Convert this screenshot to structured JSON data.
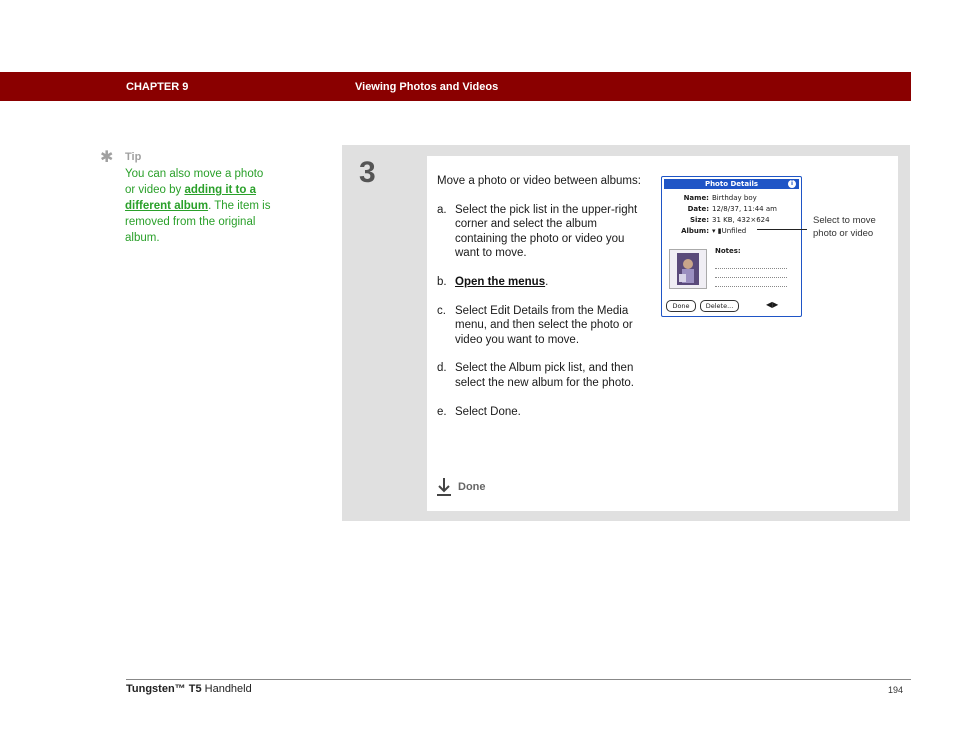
{
  "header": {
    "chapter": "CHAPTER 9",
    "section_title": "Viewing Photos and Videos"
  },
  "tip": {
    "label": "Tip",
    "text_before": "You can also move a photo or video by ",
    "link": "adding it to a different album",
    "text_after": ". The item is removed from the original album."
  },
  "step": {
    "number": "3",
    "intro": "Move a photo or video between albums:",
    "items": [
      {
        "letter": "a.",
        "text": "Select the pick list in the upper-right corner and select the album containing the photo or video you want to move."
      },
      {
        "letter": "b.",
        "link": "Open the menus",
        "suffix": "."
      },
      {
        "letter": "c.",
        "text": "Select Edit Details from the Media menu, and then select the photo or video you want to move."
      },
      {
        "letter": "d.",
        "text": "Select the Album pick list, and then select the new album for the photo."
      },
      {
        "letter": "e.",
        "text": "Select Done."
      }
    ],
    "done_label": "Done"
  },
  "device": {
    "title": "Photo Details",
    "info_icon": "i",
    "fields": {
      "name_label": "Name:",
      "name_value": "Birthday boy",
      "date_label": "Date:",
      "date_value": "12/8/37, 11:44 am",
      "size_label": "Size:",
      "size_value": "31 KB, 432×624",
      "album_label": "Album:",
      "album_value": "▾ ▮Unfiled"
    },
    "notes_label": "Notes:",
    "buttons": {
      "done": "Done",
      "delete": "Delete..."
    },
    "arrows": "◀▶"
  },
  "callout": "Select to move photo or video",
  "footer": {
    "product_name": "Tungsten™ T5",
    "product_suffix": " Handheld",
    "page_number": "194"
  },
  "colors": {
    "header": "#8a0000",
    "tip_green": "#2aa02a",
    "palm_blue": "#1f55c6",
    "step_gray": "#e0e0e0"
  }
}
